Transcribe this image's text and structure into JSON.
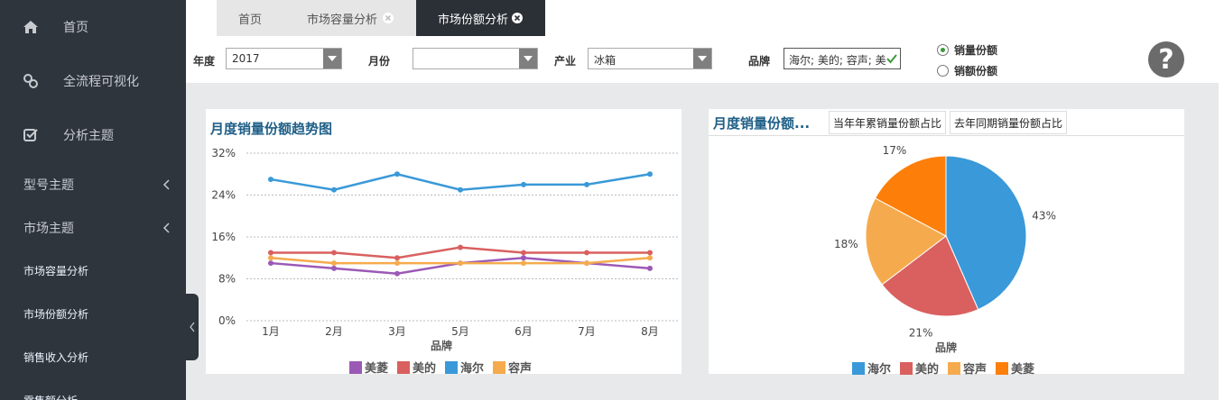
{
  "sidebar": {
    "items": [
      {
        "label": "首页",
        "icon": "home-icon"
      },
      {
        "label": "全流程可视化",
        "icon": "link-icon"
      },
      {
        "label": "分析主题",
        "icon": "check-square-icon"
      }
    ],
    "groups": [
      {
        "label": "型号主题"
      },
      {
        "label": "市场主题"
      }
    ],
    "subitems": [
      {
        "label": "市场容量分析"
      },
      {
        "label": "市场份额分析"
      },
      {
        "label": "销售收入分析"
      },
      {
        "label": "零售额分析"
      }
    ]
  },
  "tabs": [
    {
      "label": "首页",
      "active": false,
      "closable": false
    },
    {
      "label": "市场容量分析",
      "active": false,
      "closable": true
    },
    {
      "label": "市场份额分析",
      "active": true,
      "closable": true
    }
  ],
  "filters": {
    "year_label": "年度",
    "year_value": "2017",
    "month_label": "月份",
    "month_value": "",
    "industry_label": "产业",
    "industry_value": "冰箱",
    "brand_label": "品牌",
    "brand_value": "海尔; 美的; 容声; 美菱",
    "radios": [
      {
        "label": "销量份额",
        "checked": true
      },
      {
        "label": "销额份额",
        "checked": false
      }
    ],
    "help": "?"
  },
  "line_panel": {
    "title": "月度销量份额趋势图",
    "xlabel": "品牌"
  },
  "pie_panel": {
    "title": "月度销量份额...",
    "tabs": [
      "当年年累销量份额占比",
      "去年同期销量份额占比"
    ],
    "xlabel": "品牌"
  },
  "colors": {
    "美菱": "#9b59b6",
    "美的": "#d9605f",
    "海尔": "#3a99d8",
    "容声": "#f5ab4d",
    "pie_美菱": "#fd7f0a"
  },
  "chart_data": [
    {
      "type": "line",
      "title": "月度销量份额趋势图",
      "xlabel": "品牌",
      "ylabel": "",
      "categories": [
        "1月",
        "2月",
        "3月",
        "5月",
        "6月",
        "7月",
        "8月"
      ],
      "yticks": [
        "0%",
        "8%",
        "16%",
        "24%",
        "32%"
      ],
      "ylim": [
        0,
        32
      ],
      "grid": true,
      "legend_position": "bottom",
      "series": [
        {
          "name": "美菱",
          "values": [
            11,
            10,
            9,
            11,
            12,
            11,
            10
          ]
        },
        {
          "name": "美的",
          "values": [
            13,
            13,
            12,
            14,
            13,
            13,
            13
          ]
        },
        {
          "name": "海尔",
          "values": [
            27,
            25,
            28,
            25,
            26,
            26,
            28
          ]
        },
        {
          "name": "容声",
          "values": [
            12,
            11,
            11,
            11,
            11,
            11,
            12
          ]
        }
      ]
    },
    {
      "type": "pie",
      "title": "月度销量份额...",
      "xlabel": "品牌",
      "legend_position": "bottom",
      "categories": [
        "海尔",
        "美的",
        "容声",
        "美菱"
      ],
      "values": [
        43,
        21,
        18,
        17
      ],
      "labels": [
        "43%",
        "21%",
        "18%",
        "17%"
      ]
    }
  ]
}
